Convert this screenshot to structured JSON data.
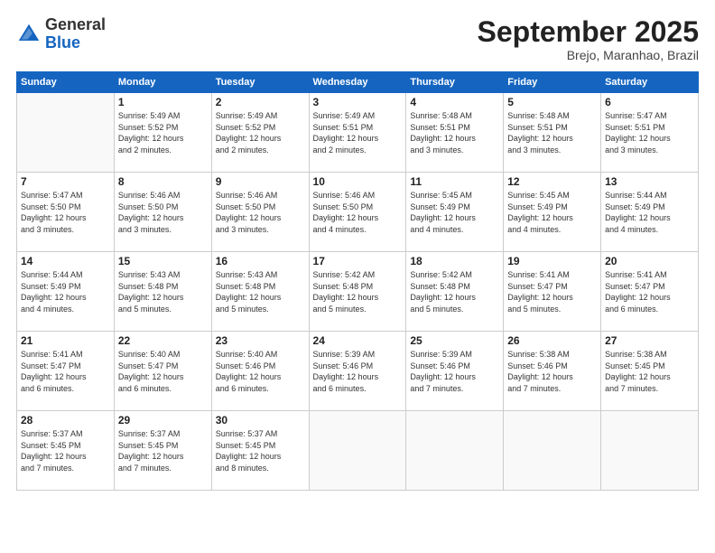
{
  "header": {
    "logo_general": "General",
    "logo_blue": "Blue",
    "month_title": "September 2025",
    "subtitle": "Brejo, Maranhao, Brazil"
  },
  "weekdays": [
    "Sunday",
    "Monday",
    "Tuesday",
    "Wednesday",
    "Thursday",
    "Friday",
    "Saturday"
  ],
  "weeks": [
    [
      {
        "day": "",
        "info": ""
      },
      {
        "day": "1",
        "info": "Sunrise: 5:49 AM\nSunset: 5:52 PM\nDaylight: 12 hours\nand 2 minutes."
      },
      {
        "day": "2",
        "info": "Sunrise: 5:49 AM\nSunset: 5:52 PM\nDaylight: 12 hours\nand 2 minutes."
      },
      {
        "day": "3",
        "info": "Sunrise: 5:49 AM\nSunset: 5:51 PM\nDaylight: 12 hours\nand 2 minutes."
      },
      {
        "day": "4",
        "info": "Sunrise: 5:48 AM\nSunset: 5:51 PM\nDaylight: 12 hours\nand 3 minutes."
      },
      {
        "day": "5",
        "info": "Sunrise: 5:48 AM\nSunset: 5:51 PM\nDaylight: 12 hours\nand 3 minutes."
      },
      {
        "day": "6",
        "info": "Sunrise: 5:47 AM\nSunset: 5:51 PM\nDaylight: 12 hours\nand 3 minutes."
      }
    ],
    [
      {
        "day": "7",
        "info": "Sunrise: 5:47 AM\nSunset: 5:50 PM\nDaylight: 12 hours\nand 3 minutes."
      },
      {
        "day": "8",
        "info": "Sunrise: 5:46 AM\nSunset: 5:50 PM\nDaylight: 12 hours\nand 3 minutes."
      },
      {
        "day": "9",
        "info": "Sunrise: 5:46 AM\nSunset: 5:50 PM\nDaylight: 12 hours\nand 3 minutes."
      },
      {
        "day": "10",
        "info": "Sunrise: 5:46 AM\nSunset: 5:50 PM\nDaylight: 12 hours\nand 4 minutes."
      },
      {
        "day": "11",
        "info": "Sunrise: 5:45 AM\nSunset: 5:49 PM\nDaylight: 12 hours\nand 4 minutes."
      },
      {
        "day": "12",
        "info": "Sunrise: 5:45 AM\nSunset: 5:49 PM\nDaylight: 12 hours\nand 4 minutes."
      },
      {
        "day": "13",
        "info": "Sunrise: 5:44 AM\nSunset: 5:49 PM\nDaylight: 12 hours\nand 4 minutes."
      }
    ],
    [
      {
        "day": "14",
        "info": "Sunrise: 5:44 AM\nSunset: 5:49 PM\nDaylight: 12 hours\nand 4 minutes."
      },
      {
        "day": "15",
        "info": "Sunrise: 5:43 AM\nSunset: 5:48 PM\nDaylight: 12 hours\nand 5 minutes."
      },
      {
        "day": "16",
        "info": "Sunrise: 5:43 AM\nSunset: 5:48 PM\nDaylight: 12 hours\nand 5 minutes."
      },
      {
        "day": "17",
        "info": "Sunrise: 5:42 AM\nSunset: 5:48 PM\nDaylight: 12 hours\nand 5 minutes."
      },
      {
        "day": "18",
        "info": "Sunrise: 5:42 AM\nSunset: 5:48 PM\nDaylight: 12 hours\nand 5 minutes."
      },
      {
        "day": "19",
        "info": "Sunrise: 5:41 AM\nSunset: 5:47 PM\nDaylight: 12 hours\nand 5 minutes."
      },
      {
        "day": "20",
        "info": "Sunrise: 5:41 AM\nSunset: 5:47 PM\nDaylight: 12 hours\nand 6 minutes."
      }
    ],
    [
      {
        "day": "21",
        "info": "Sunrise: 5:41 AM\nSunset: 5:47 PM\nDaylight: 12 hours\nand 6 minutes."
      },
      {
        "day": "22",
        "info": "Sunrise: 5:40 AM\nSunset: 5:47 PM\nDaylight: 12 hours\nand 6 minutes."
      },
      {
        "day": "23",
        "info": "Sunrise: 5:40 AM\nSunset: 5:46 PM\nDaylight: 12 hours\nand 6 minutes."
      },
      {
        "day": "24",
        "info": "Sunrise: 5:39 AM\nSunset: 5:46 PM\nDaylight: 12 hours\nand 6 minutes."
      },
      {
        "day": "25",
        "info": "Sunrise: 5:39 AM\nSunset: 5:46 PM\nDaylight: 12 hours\nand 7 minutes."
      },
      {
        "day": "26",
        "info": "Sunrise: 5:38 AM\nSunset: 5:46 PM\nDaylight: 12 hours\nand 7 minutes."
      },
      {
        "day": "27",
        "info": "Sunrise: 5:38 AM\nSunset: 5:45 PM\nDaylight: 12 hours\nand 7 minutes."
      }
    ],
    [
      {
        "day": "28",
        "info": "Sunrise: 5:37 AM\nSunset: 5:45 PM\nDaylight: 12 hours\nand 7 minutes."
      },
      {
        "day": "29",
        "info": "Sunrise: 5:37 AM\nSunset: 5:45 PM\nDaylight: 12 hours\nand 7 minutes."
      },
      {
        "day": "30",
        "info": "Sunrise: 5:37 AM\nSunset: 5:45 PM\nDaylight: 12 hours\nand 8 minutes."
      },
      {
        "day": "",
        "info": ""
      },
      {
        "day": "",
        "info": ""
      },
      {
        "day": "",
        "info": ""
      },
      {
        "day": "",
        "info": ""
      }
    ]
  ]
}
